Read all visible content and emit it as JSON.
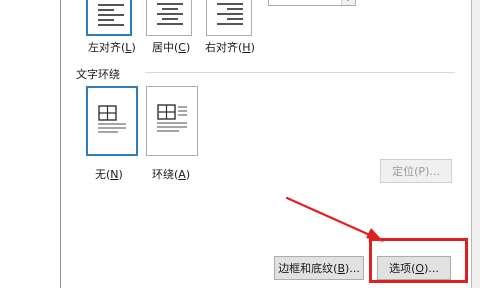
{
  "alignment": {
    "options": [
      {
        "label": "左对齐(L)",
        "text": "左对齐(",
        "key": "L",
        "close": ")",
        "selected": true,
        "style": "left"
      },
      {
        "label": "居中(C)",
        "text": "居中(",
        "key": "C",
        "close": ")",
        "selected": false,
        "style": "center"
      },
      {
        "label": "右对齐(H)",
        "text": "右对齐(",
        "key": "H",
        "close": ")",
        "selected": false,
        "style": "right"
      }
    ]
  },
  "text_wrap": {
    "title": "文字环绕",
    "options": [
      {
        "label": "无(N)",
        "text": "无(",
        "key": "N",
        "close": ")",
        "selected": true
      },
      {
        "label": "环绕(A)",
        "text": "环绕(",
        "key": "A",
        "close": ")",
        "selected": false
      }
    ],
    "position_button": "定位(P)..."
  },
  "buttons": {
    "borders_shading": {
      "text": "边框和底纹(",
      "key": "B",
      "close": ")..."
    },
    "options": {
      "text": "选项(",
      "key": "O",
      "close": ")..."
    }
  },
  "annotation": {
    "highlight_color": "#e0201e",
    "arrow_color": "#e0201e"
  },
  "colors": {
    "selected_border": "#2d7fb8"
  }
}
